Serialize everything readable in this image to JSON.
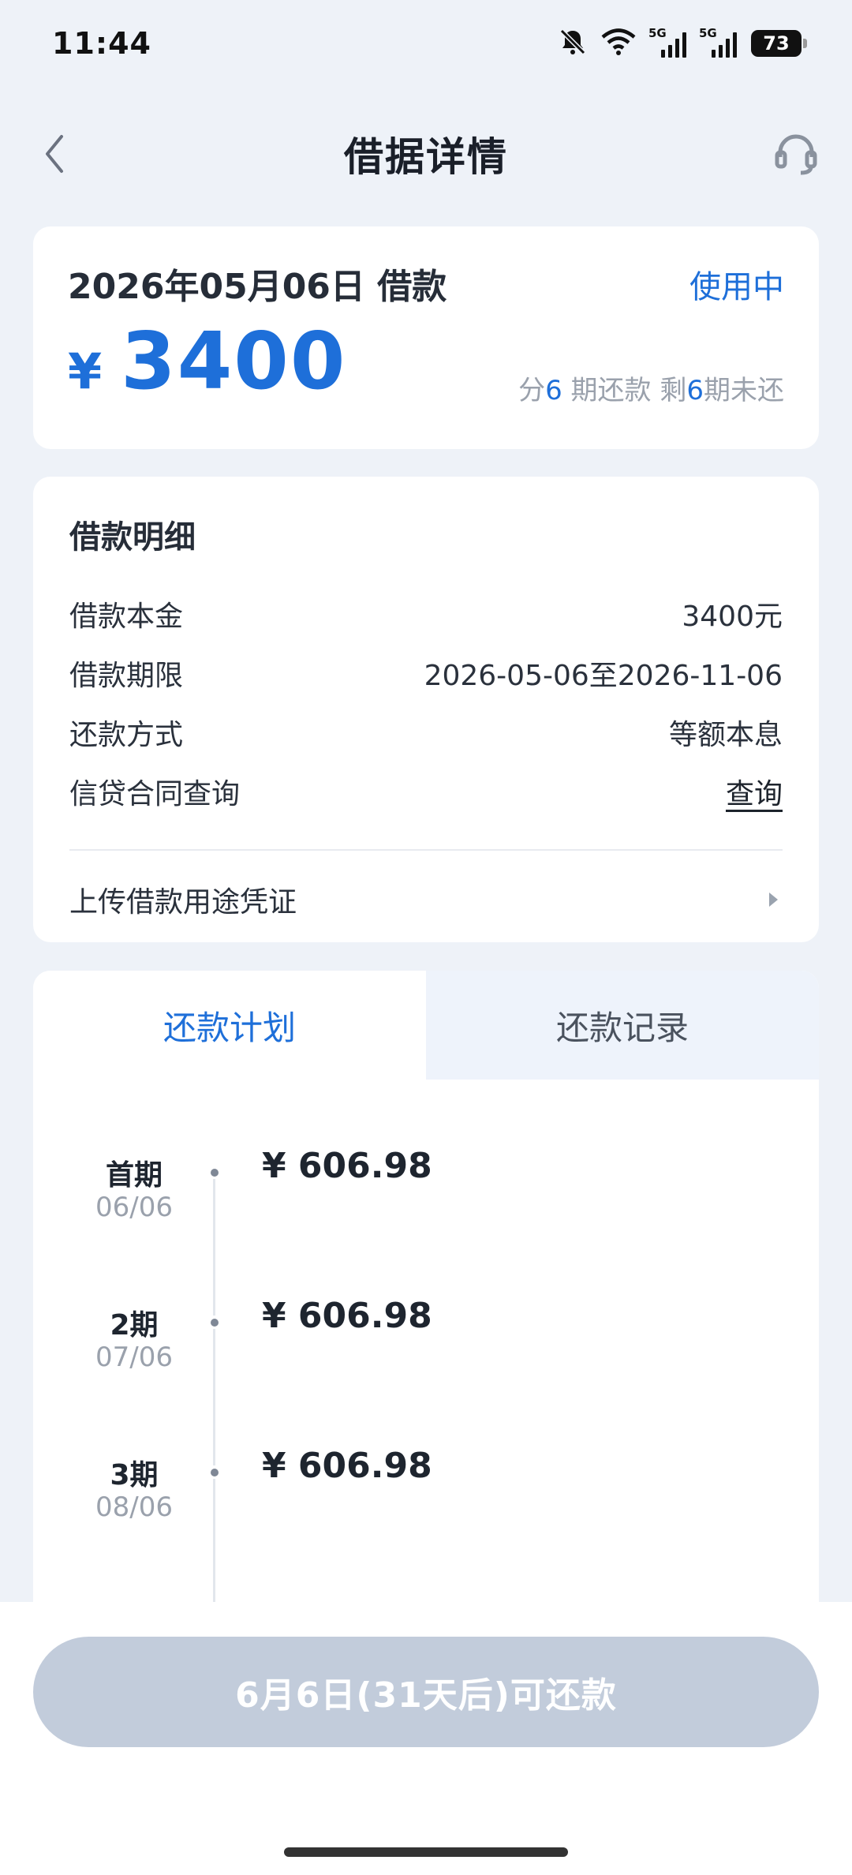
{
  "status_bar": {
    "time": "11:44",
    "network_1": "5G",
    "network_2": "5G",
    "battery": "73",
    "icons": [
      "bell-muted-icon",
      "wifi-icon",
      "signal-icon",
      "signal-icon",
      "battery-icon"
    ]
  },
  "nav": {
    "title": "借据详情",
    "back_icon": "chevron-left-icon",
    "service_icon": "headset-icon"
  },
  "summary": {
    "date_label": "2026年05月06日 借款",
    "status": "使用中",
    "currency": "¥",
    "amount": "3400",
    "installments_prefix": "分",
    "installments_total": "6",
    "installments_mid": " 期还款 剩",
    "installments_left": "6",
    "installments_suffix": "期未还"
  },
  "details": {
    "title": "借款明细",
    "rows": [
      {
        "label": "借款本金",
        "value": "3400元"
      },
      {
        "label": "借款期限",
        "value": "2026-05-06至2026-11-06"
      },
      {
        "label": "还款方式",
        "value": "等额本息"
      },
      {
        "label": "信贷合同查询",
        "value": "查询"
      }
    ],
    "upload_label": "上传借款用途凭证"
  },
  "plan": {
    "tabs": [
      "还款计划",
      "还款记录"
    ],
    "items": [
      {
        "period": "首期",
        "date": "06/06",
        "amount": "¥ 606.98"
      },
      {
        "period": "2期",
        "date": "07/06",
        "amount": "¥ 606.98"
      },
      {
        "period": "3期",
        "date": "08/06",
        "amount": "¥ 606.98"
      }
    ]
  },
  "footer": {
    "button_label": "6月6日(31天后)可还款"
  },
  "colors": {
    "accent": "#1e6fd9",
    "background": "#eef2f8",
    "disabled_button": "#c2ccdb"
  }
}
